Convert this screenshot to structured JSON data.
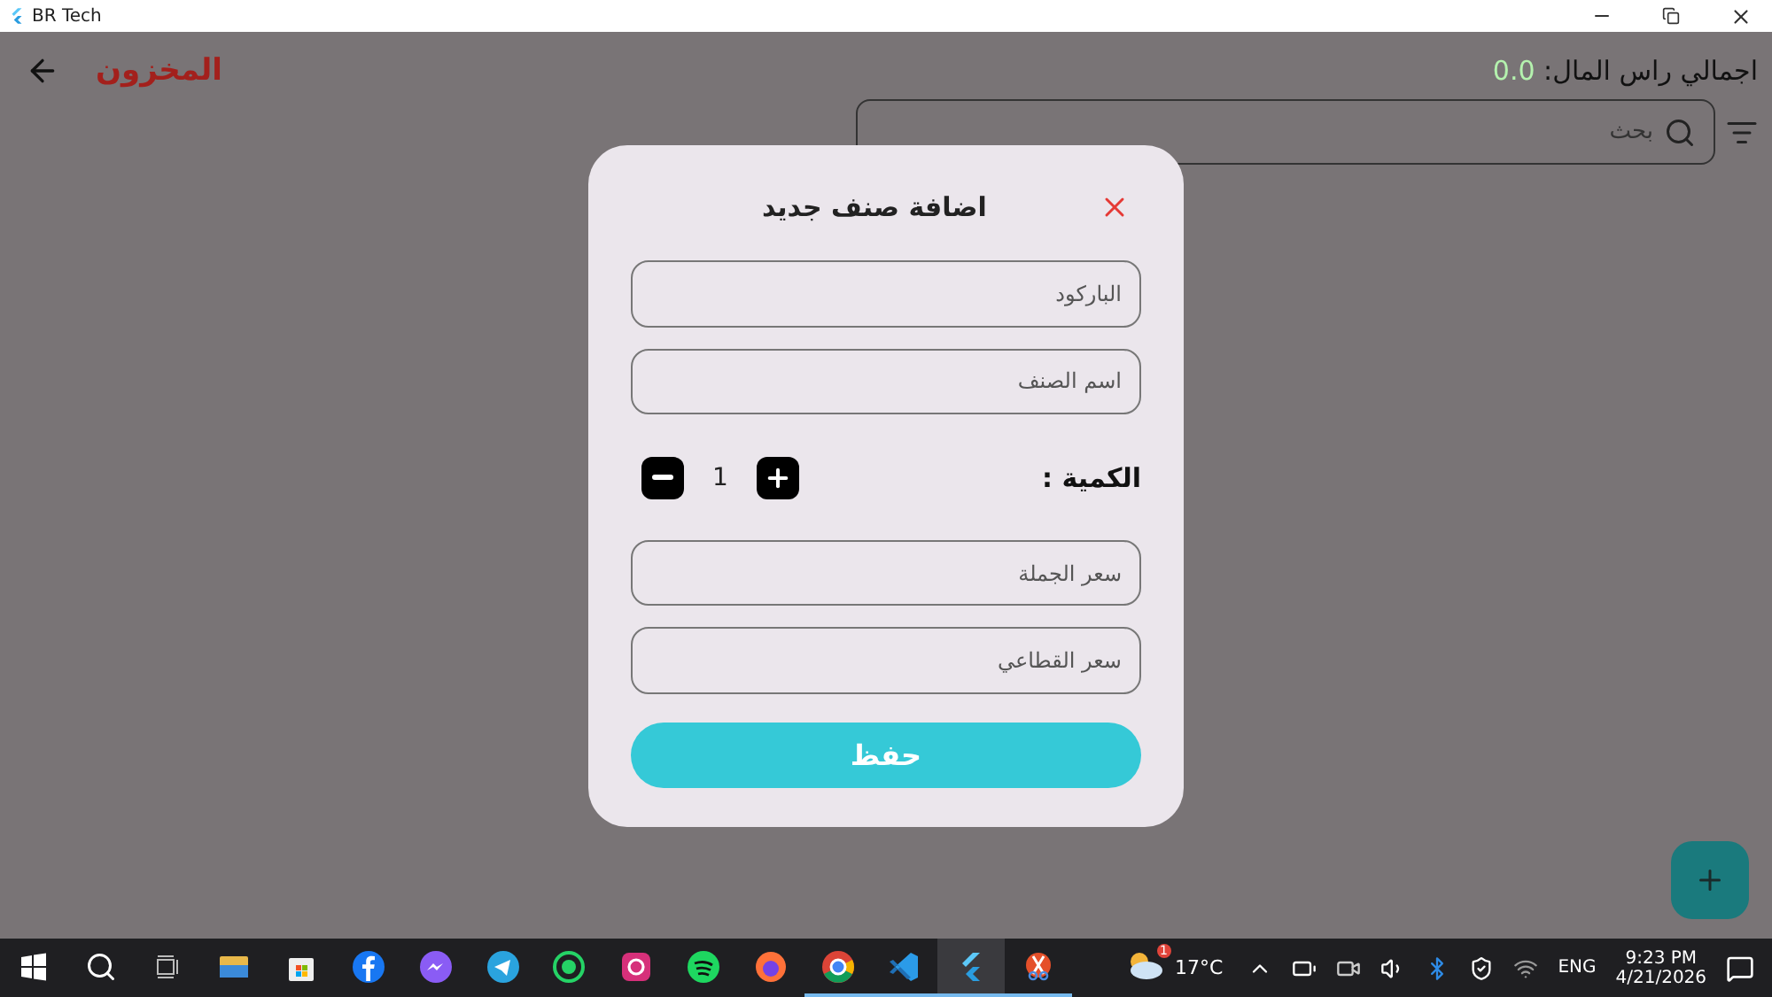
{
  "window": {
    "title": "BR Tech"
  },
  "header": {
    "title": "المخزون",
    "capital_label": "اجمالي راس المال:",
    "capital_value": "0.0"
  },
  "search": {
    "placeholder": "بحث"
  },
  "dialog": {
    "title": "اضافة صنف جديد",
    "fields": [
      {
        "placeholder": "الباركود"
      },
      {
        "placeholder": "اسم الصنف"
      }
    ],
    "quantity": {
      "label": "الكمية :",
      "value": "1"
    },
    "price_fields": [
      {
        "placeholder": "سعر الجملة"
      },
      {
        "placeholder": "سعر القطاعي"
      }
    ],
    "save_button": "حفظ"
  },
  "taskbar": {
    "apps": [
      {
        "kind": "files",
        "running": false,
        "selected": false
      },
      {
        "kind": "store",
        "running": false,
        "selected": false
      },
      {
        "kind": "facebook",
        "running": false,
        "selected": false
      },
      {
        "kind": "messenger",
        "running": false,
        "selected": false
      },
      {
        "kind": "telegram",
        "running": false,
        "selected": false
      },
      {
        "kind": "whatsapp",
        "running": false,
        "selected": false
      },
      {
        "kind": "instagram",
        "running": false,
        "selected": false
      },
      {
        "kind": "spotify",
        "running": false,
        "selected": false
      },
      {
        "kind": "firefox",
        "running": false,
        "selected": false
      },
      {
        "kind": "chrome",
        "running": true,
        "selected": false
      },
      {
        "kind": "vscode",
        "running": true,
        "selected": false
      },
      {
        "kind": "flutter",
        "running": true,
        "selected": true
      },
      {
        "kind": "snip",
        "running": true,
        "selected": false
      }
    ],
    "weather": "17°C",
    "weather_badge": "1",
    "language": "ENG",
    "time": "9:23 PM",
    "date": "4/21/2026"
  }
}
